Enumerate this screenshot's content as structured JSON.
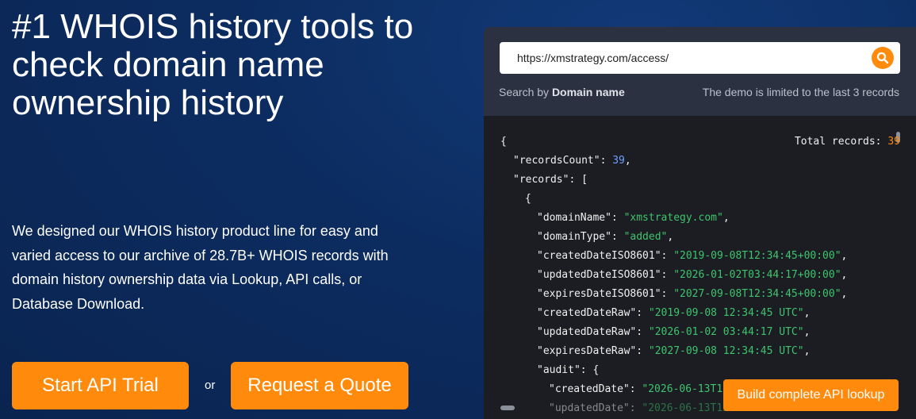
{
  "hero": {
    "headline": "#1 WHOIS history tools to check domain name ownership history",
    "description": "We designed our WHOIS history product line for easy and varied access to our archive of 28.7B+ WHOIS records with domain history ownership data via Lookup, API calls, or Database Download."
  },
  "actions": {
    "trial_label": "Start API Trial",
    "or_label": "or",
    "quote_label": "Request a Quote"
  },
  "demo": {
    "search_value": "https://xmstrategy.com/access/",
    "search_by_prefix": "Search by",
    "search_by_field": "Domain name",
    "limit_note": "The demo is limited to the last 3 records",
    "total_records_label": "Total records:",
    "total_records_value": "39",
    "build_button_label": "Build complete API lookup"
  },
  "json_result": {
    "open_brace": "{",
    "records_count_key": "\"recordsCount\"",
    "records_count_value": "39",
    "records_key": "\"records\"",
    "records_open": "[",
    "record_open": "{",
    "domain_name_key": "\"domainName\"",
    "domain_name_value": "\"xmstrategy.com\"",
    "domain_type_key": "\"domainType\"",
    "domain_type_value": "\"added\"",
    "created_iso_key": "\"createdDateISO8601\"",
    "created_iso_value": "\"2019-09-08T12:34:45+00:00\"",
    "updated_iso_key": "\"updatedDateISO8601\"",
    "updated_iso_value": "\"2026-01-02T03:44:17+00:00\"",
    "expires_iso_key": "\"expiresDateISO8601\"",
    "expires_iso_value": "\"2027-09-08T12:34:45+00:00\"",
    "created_raw_key": "\"createdDateRaw\"",
    "created_raw_value": "\"2019-09-08 12:34:45 UTC\"",
    "updated_raw_key": "\"updatedDateRaw\"",
    "updated_raw_value": "\"2026-01-02 03:44:17 UTC\"",
    "expires_raw_key": "\"expiresDateRaw\"",
    "expires_raw_value": "\"2027-09-08 12:34:45 UTC\"",
    "audit_key": "\"audit\"",
    "audit_open": "{",
    "audit_created_key": "\"createdDate\"",
    "audit_created_value": "\"2026-06-13T12",
    "audit_updated_key": "\"updatedDate\"",
    "audit_updated_value": "\"2026-06-13T12"
  },
  "colors": {
    "accent": "#ff8a0c",
    "json_string": "#3ec46d",
    "json_number": "#6ea0ff"
  },
  "icons": {
    "search": "search-icon"
  }
}
